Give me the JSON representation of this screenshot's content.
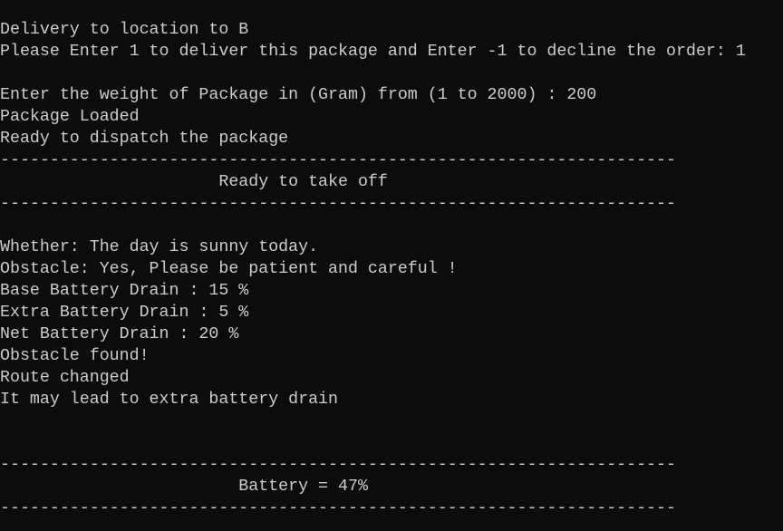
{
  "console": {
    "lines": [
      "Delivery to location to B",
      "Please Enter 1 to deliver this package and Enter -1 to decline the order: 1",
      "",
      "Enter the weight of Package in (Gram) from (1 to 2000) : 200",
      "Package Loaded",
      "Ready to dispatch the package",
      "--------------------------------------------------------------------",
      "                      Ready to take off",
      "--------------------------------------------------------------------",
      "",
      "Whether: The day is sunny today.",
      "Obstacle: Yes, Please be patient and careful !",
      "Base Battery Drain : 15 %",
      "Extra Battery Drain : 5 %",
      "Net Battery Drain : 20 %",
      "Obstacle found!",
      "Route changed",
      "It may lead to extra battery drain",
      "",
      "",
      "--------------------------------------------------------------------",
      "                        Battery = 47%",
      "--------------------------------------------------------------------"
    ]
  },
  "colors": {
    "background": "#0c0c0c",
    "text": "#cccccc"
  }
}
